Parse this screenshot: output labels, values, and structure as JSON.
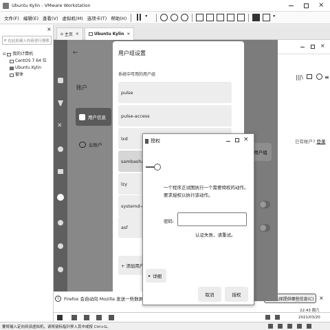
{
  "window": {
    "title": "Ubuntu Kylin - VMware Workstation"
  },
  "menubar": {
    "items": [
      "文件(F)",
      "编辑(E)",
      "查看(V)",
      "虚拟机(M)",
      "选项卡(T)",
      "帮助(H)"
    ]
  },
  "library": {
    "search_placeholder": "在此处键入内容进行搜索",
    "root": "我的计算机",
    "vms": [
      "CentOS 7 64 位",
      "Ubuntu Kylin",
      "窗体"
    ]
  },
  "tabs": [
    {
      "label": "主页"
    },
    {
      "label": "Ubuntu Kylin"
    }
  ],
  "settings": {
    "section": "账户",
    "items": [
      {
        "label": "用户信息",
        "active": true
      },
      {
        "label": "云账户",
        "active": false
      }
    ]
  },
  "usergroup": {
    "title": "用户组设置",
    "subtitle": "系统中可用的用户组",
    "groups": [
      "pulse",
      "pulse-access",
      "lxd",
      "sambashare",
      "lzy",
      "systemd-coredump",
      "asf"
    ],
    "add_label": "+ 添加用户组",
    "right_btn": "用户组"
  },
  "background_page": {
    "link_text": "已有帐户?",
    "login": "登录",
    "firefox_text": "Firefox 会自动向 Mozilla 发送一些数据",
    "choose_btn": "我要选择提供哪些信息(C)",
    "time": "22:43 周六",
    "date": "2021/03/20"
  },
  "auth": {
    "title": "授权",
    "message": "一个程序正试图执行一个需要特权的动作。要求授权以执行该动作。",
    "password_label": "密码:",
    "password_value": "",
    "error": "认证失败，请重试。",
    "details": "详细",
    "cancel": "取消",
    "ok": "授权"
  },
  "statusbar": {
    "text": "要将输入定向到该虚拟机，请将鼠标指针移入其中或按 Ctrl+G。"
  }
}
